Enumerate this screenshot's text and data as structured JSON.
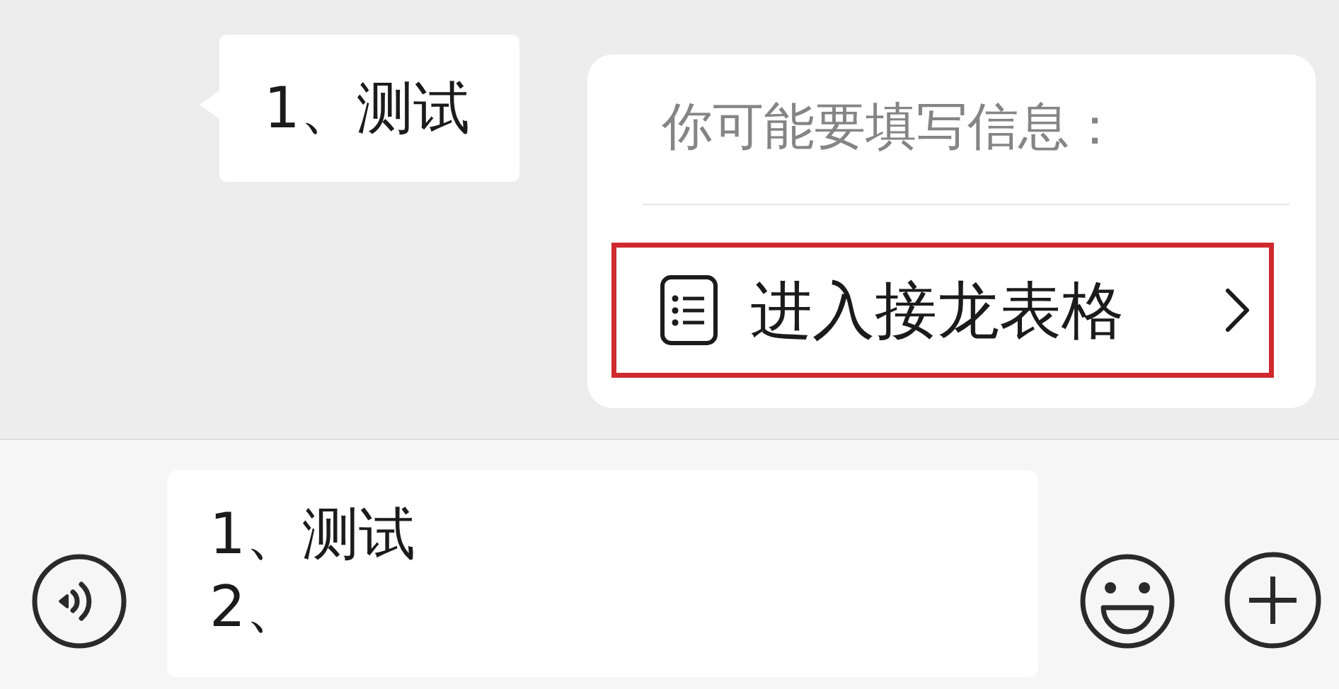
{
  "messages": [
    {
      "kind": "text",
      "text": "1、测试"
    }
  ],
  "suggestion_card": {
    "title": "你可能要填写信息：",
    "action": {
      "label": "进入接龙表格",
      "highlighted": true
    }
  },
  "input_bar": {
    "value": "1、测试\n2、"
  }
}
